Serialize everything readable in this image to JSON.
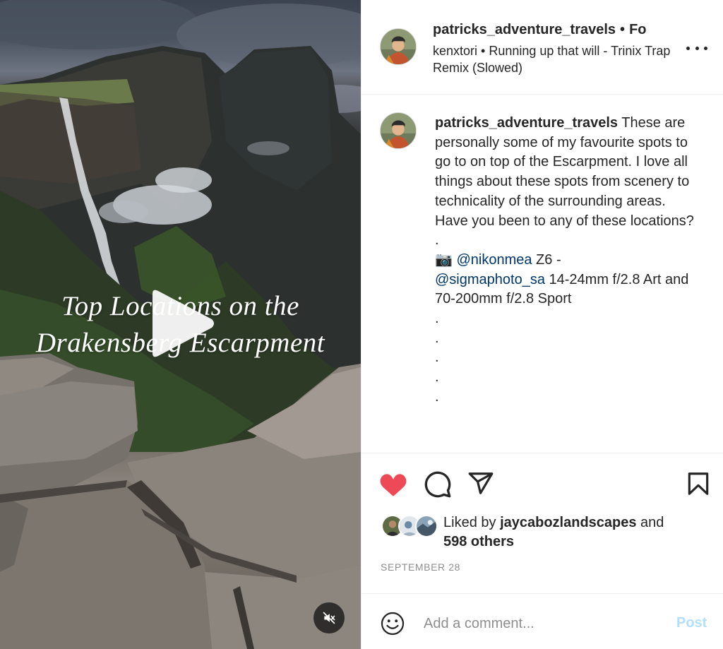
{
  "media": {
    "overlay_title_line1": "Top Locations on the",
    "overlay_title_line2": "Drakensberg Escarpment"
  },
  "header": {
    "username": "patricks_adventure_travels",
    "separator": "•",
    "follow_label": "Fo",
    "audio": "kenxtori • Running up that will - Trinix Trap Remix (Slowed)"
  },
  "caption": {
    "username": "patricks_adventure_travels",
    "text": " These are personally some of my favourite spots to go to on top of the Escarpment. I love all things about these spots from scenery to technicality of the surrounding areas. Have you been to any of these locations?",
    "dot": ".",
    "camera_emoji": "📷",
    "mention1": "@nikonmea",
    "gear1": " Z6 -",
    "mention2": "@sigmaphoto_sa",
    "gear2": " 14-24mm f/2.8 Art and 70-200mm f/2.8 Sport"
  },
  "likes": {
    "prefix": "Liked by ",
    "liker": "jaycabozlandscapes",
    "and": " and",
    "others": "598 others"
  },
  "date": "SEPTEMBER 28",
  "comment": {
    "placeholder": "Add a comment...",
    "post_label": "Post"
  },
  "colors": {
    "like_red": "#ed4956",
    "mention_blue": "#00376b",
    "post_disabled": "#b2dffc"
  },
  "icons": [
    "play-icon",
    "mute-icon",
    "more-icon",
    "heart-icon",
    "comment-icon",
    "share-icon",
    "bookmark-icon",
    "emoji-icon",
    "camera-emoji"
  ]
}
